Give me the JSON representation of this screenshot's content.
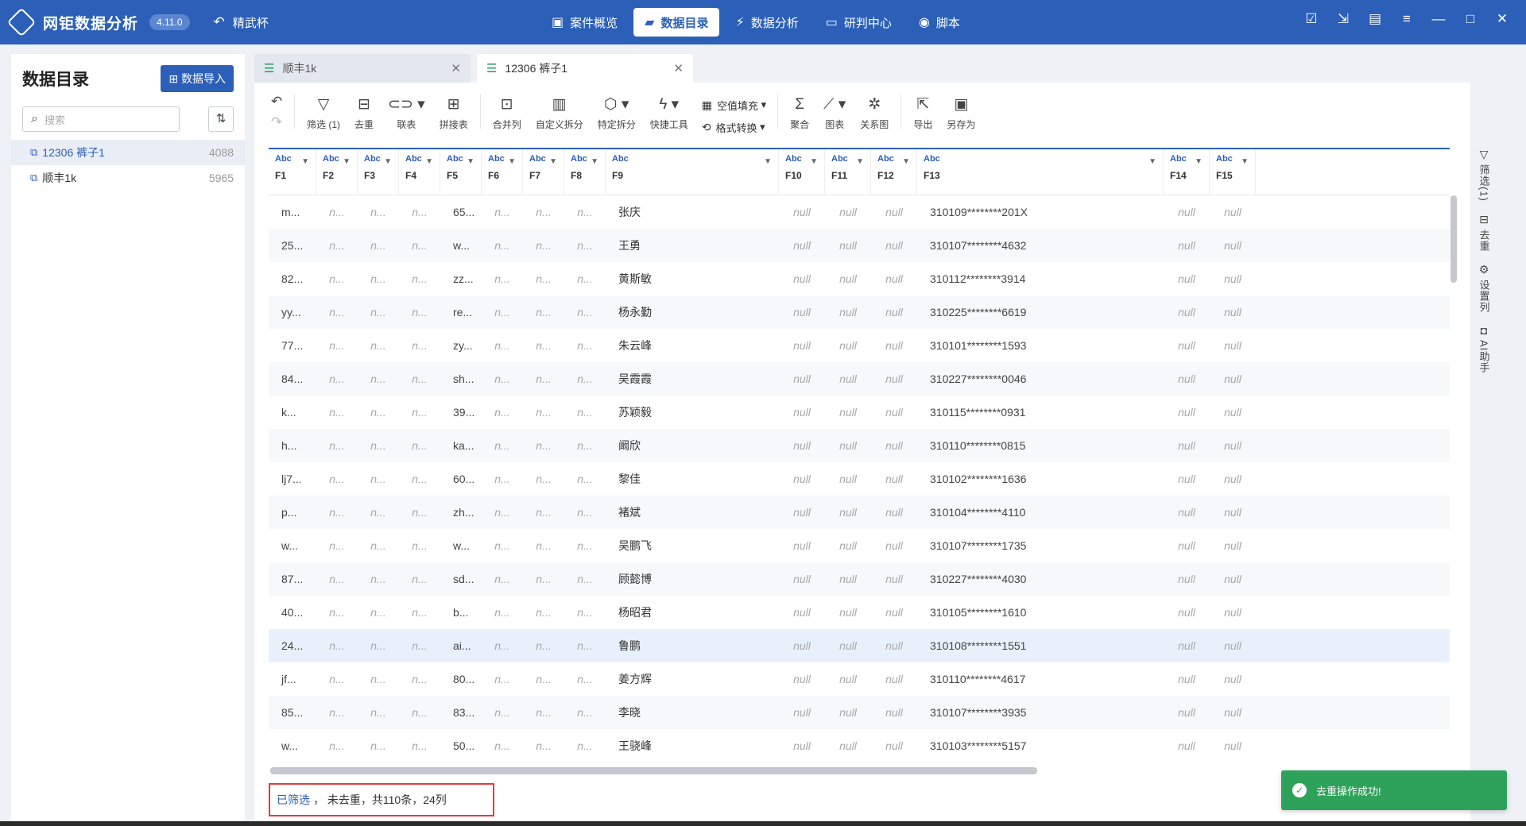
{
  "app": {
    "title": "网钜数据分析",
    "version": "4.11.0",
    "case_name": "精武杯"
  },
  "nav": [
    {
      "label": "案件概览",
      "icon": "briefcase-icon"
    },
    {
      "label": "数据目录",
      "icon": "folder-icon",
      "active": true
    },
    {
      "label": "数据分析",
      "icon": "analysis-icon"
    },
    {
      "label": "研判中心",
      "icon": "monitor-icon"
    },
    {
      "label": "脚本",
      "icon": "script-icon"
    }
  ],
  "sidebar": {
    "title": "数据目录",
    "import_label": "数据导入",
    "search_placeholder": "搜索",
    "items": [
      {
        "label": "12306 裤子1",
        "count": "4088"
      },
      {
        "label": "顺丰1k",
        "count": "5965"
      }
    ]
  },
  "tabs": [
    {
      "label": "顺丰1k"
    },
    {
      "label": "12306 裤子1"
    }
  ],
  "toolbar": {
    "filter": "筛选 (1)",
    "dedup": "去重",
    "join": "联表",
    "concat": "拼接表",
    "merge_cols": "合并列",
    "custom_split": "自定义拆分",
    "specific_split": "特定拆分",
    "quick_tools": "快捷工具",
    "fill_null": "空值填充",
    "format_convert": "格式转换",
    "aggregate": "聚合",
    "chart": "图表",
    "relation": "关系图",
    "export": "导出",
    "save_as": "另存为"
  },
  "grid": {
    "type_label": "Abc",
    "columns": [
      "F1",
      "F2",
      "F3",
      "F4",
      "F5",
      "F6",
      "F7",
      "F8",
      "F9",
      "F10",
      "F11",
      "F12",
      "F13",
      "F14",
      "F15"
    ],
    "null_text": "null",
    "rows": [
      {
        "f1": "m...",
        "f5": "65...",
        "name": "张庆",
        "id": "310109********201X"
      },
      {
        "f1": "25...",
        "f5": "w...",
        "name": "王勇",
        "id": "310107********4632"
      },
      {
        "f1": "82...",
        "f5": "zz...",
        "name": "黄斯敏",
        "id": "310112********3914"
      },
      {
        "f1": "yy...",
        "f5": "re...",
        "name": "杨永勤",
        "id": "310225********6619"
      },
      {
        "f1": "77...",
        "f5": "zy...",
        "name": "朱云峰",
        "id": "310101********1593"
      },
      {
        "f1": "84...",
        "f5": "sh...",
        "name": "吴霞霞",
        "id": "310227********0046"
      },
      {
        "f1": "k...",
        "f5": "39...",
        "name": "苏颖毅",
        "id": "310115********0931"
      },
      {
        "f1": "h...",
        "f5": "ka...",
        "name": "阚欣",
        "id": "310110********0815"
      },
      {
        "f1": "lj7...",
        "f5": "60...",
        "name": "黎佳",
        "id": "310102********1636"
      },
      {
        "f1": "p...",
        "f5": "zh...",
        "name": "褚斌",
        "id": "310104********4110"
      },
      {
        "f1": "w...",
        "f5": "w...",
        "name": "吴鹏飞",
        "id": "310107********1735"
      },
      {
        "f1": "87...",
        "f5": "sd...",
        "name": "顾懿博",
        "id": "310227********4030"
      },
      {
        "f1": "40...",
        "f5": "b...",
        "name": "杨昭君",
        "id": "310105********1610"
      },
      {
        "f1": "24...",
        "f5": "ai...",
        "name": "鲁鹏",
        "id": "310108********1551"
      },
      {
        "f1": "jf...",
        "f5": "80...",
        "name": "姜方辉",
        "id": "310110********4617"
      },
      {
        "f1": "85...",
        "f5": "83...",
        "name": "李晓",
        "id": "310107********3935"
      },
      {
        "f1": "w...",
        "f5": "50...",
        "name": "王骁峰",
        "id": "310103********5157"
      }
    ]
  },
  "rightbar": {
    "filter": "筛选(1)",
    "dedup": "去重",
    "settings": "设置列",
    "ai": "AI助手"
  },
  "status": {
    "filtered": "已筛选",
    "rest": "， 未去重，共110条，24列"
  },
  "toast": {
    "message": "去重操作成功!"
  }
}
